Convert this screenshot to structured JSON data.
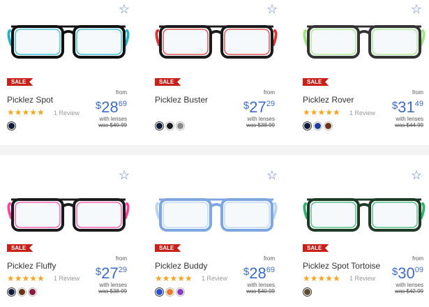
{
  "products": [
    {
      "badge": "SALE",
      "name": "Picklez Spot",
      "stars": "★★★★★",
      "reviews": "1 Review",
      "from": "from",
      "currency": "$",
      "dollars": "28",
      "cents": "69",
      "with_lenses": "with lenses",
      "was": "was $40.99",
      "frame_color": "#111111",
      "accent_color": "#1fb3c9",
      "swatches": [
        "#101a3a"
      ]
    },
    {
      "badge": "SALE",
      "name": "Picklez Buster",
      "stars": "",
      "reviews": "",
      "from": "from",
      "currency": "$",
      "dollars": "27",
      "cents": "29",
      "with_lenses": "with lenses",
      "was": "was $38.99",
      "frame_color": "#1a1a1a",
      "accent_color": "#e03131",
      "swatches": [
        "#101a3a",
        "#1a1a1a",
        "#8a8a8a"
      ]
    },
    {
      "badge": "SALE",
      "name": "Picklez Rover",
      "stars": "★★★★★",
      "reviews": "1 Review",
      "from": "from",
      "currency": "$",
      "dollars": "31",
      "cents": "49",
      "with_lenses": "with lenses",
      "was": "was $44.99",
      "frame_color": "#333333",
      "accent_color": "#9ee67a",
      "swatches": [
        "#101a3a",
        "#1d3fa0",
        "#6b3414"
      ]
    },
    {
      "badge": "SALE",
      "name": "Picklez Fluffy",
      "stars": "★★★★★",
      "reviews": "1 Review",
      "from": "from",
      "currency": "$",
      "dollars": "27",
      "cents": "29",
      "with_lenses": "with lenses",
      "was": "was $38.99",
      "frame_color": "#1a1a1a",
      "accent_color": "#ff3f9b",
      "swatches": [
        "#101a3a",
        "#6b3414",
        "#8c1a3c"
      ]
    },
    {
      "badge": "SALE",
      "name": "Picklez Buddy",
      "stars": "★★★★★",
      "reviews": "1 Review",
      "from": "from",
      "currency": "$",
      "dollars": "28",
      "cents": "69",
      "with_lenses": "with lenses",
      "was": "was $40.99",
      "frame_color": "#7ea6e0",
      "accent_color": "#b9d3f4",
      "swatches": [
        "#2a4fd0",
        "#f07a26",
        "#8a3cc4"
      ]
    },
    {
      "badge": "SALE",
      "name": "Picklez Spot Tortoise",
      "stars": "★★★★★",
      "reviews": "1 Review",
      "from": "from",
      "currency": "$",
      "dollars": "30",
      "cents": "09",
      "with_lenses": "with lenses",
      "was": "was $42.99",
      "frame_color": "#1c3a23",
      "accent_color": "#2fb36a",
      "swatches": [
        "#5c4a2a"
      ]
    }
  ],
  "icons": {
    "favorite": "star-outline-icon"
  },
  "colors": {
    "price": "#3d6bcb",
    "sale": "#c8211a",
    "stars": "#f5a623",
    "favorite": "#5b7fd1"
  }
}
